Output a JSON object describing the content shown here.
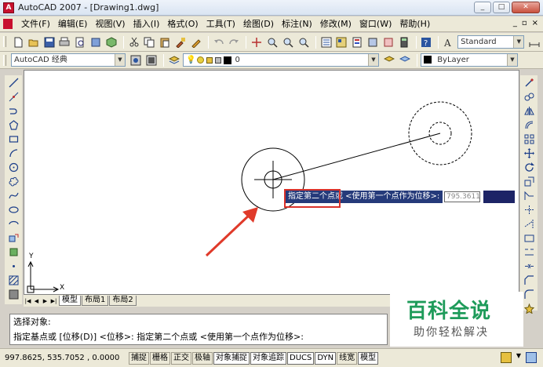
{
  "window": {
    "title": "AutoCAD 2007 - [Drawing1.dwg]",
    "min_glyph": "_",
    "max_glyph": "□",
    "close_glyph": "✕"
  },
  "menu": {
    "items": [
      "文件(F)",
      "编辑(E)",
      "视图(V)",
      "插入(I)",
      "格式(O)",
      "工具(T)",
      "绘图(D)",
      "标注(N)",
      "修改(M)",
      "窗口(W)",
      "帮助(H)"
    ],
    "mdi_min": "_",
    "mdi_restore": "▫",
    "mdi_close": "×"
  },
  "toolbar1": {
    "text_style": "Standard"
  },
  "toolbar2": {
    "workspace": "AutoCAD 经典",
    "layer": "0",
    "color": "ByLayer"
  },
  "canvas": {
    "prompt_text": "指定第二个点或 <使用第一个点作为位移>:",
    "coord_value": "795.3611",
    "ucs_y": "Y",
    "ucs_x": "X"
  },
  "tabs": {
    "items": [
      "模型",
      "布局1",
      "布局2"
    ],
    "active_index": 0
  },
  "command": {
    "line1": "选择对象:",
    "line2": "指定基点或 [位移(D)] <位移>:  指定第二个点或 <使用第一个点作为位移>:"
  },
  "status": {
    "coords": "997.8625,  535.7052 , 0.0000",
    "buttons": [
      "捕捉",
      "栅格",
      "正交",
      "极轴",
      "对象捕捉",
      "对象追踪",
      "DUCS",
      "DYN",
      "线宽",
      "模型"
    ],
    "active_buttons": [
      "对象捕捉",
      "对象追踪",
      "DUCS",
      "DYN",
      "模型"
    ]
  },
  "watermark": {
    "logo": "百科全说",
    "subtitle": "助你轻松解决"
  },
  "colors": {
    "prompt_bg": "#253a7a",
    "highlight_red": "#d9322b",
    "watermark_green": "#1e9b5a"
  }
}
